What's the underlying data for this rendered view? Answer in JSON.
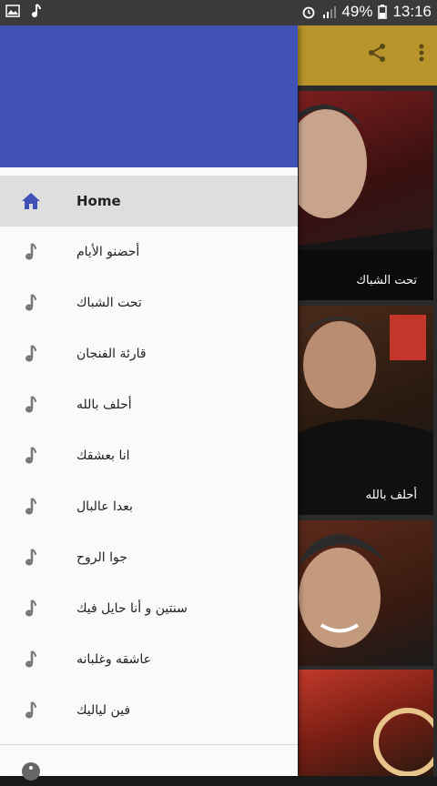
{
  "status_bar": {
    "battery": "49%",
    "time": "13:16",
    "left_icons": [
      "image-icon",
      "music-note-icon"
    ],
    "right_icons": [
      "alarm-icon",
      "signal-icon",
      "battery-icon"
    ]
  },
  "app": {
    "accent": "#b8942a",
    "toolbar_icons": [
      "share-icon",
      "more-vert-icon"
    ],
    "cards": [
      {
        "title": "تحت الشباك"
      },
      {
        "title": "أحلف بالله"
      },
      {
        "title": ""
      }
    ]
  },
  "drawer": {
    "header_color": "#3f51b5",
    "items": [
      {
        "label": "Home",
        "icon": "home-icon",
        "active": true
      },
      {
        "label": "أحضنو الأيام",
        "icon": "music-note-icon"
      },
      {
        "label": "تحت الشباك",
        "icon": "music-note-icon"
      },
      {
        "label": "قارئة الفنجان",
        "icon": "music-note-icon"
      },
      {
        "label": "أحلف بالله",
        "icon": "music-note-icon"
      },
      {
        "label": "انا بعشقك",
        "icon": "music-note-icon"
      },
      {
        "label": "بعدا عالبال",
        "icon": "music-note-icon"
      },
      {
        "label": "جوا الروح",
        "icon": "music-note-icon"
      },
      {
        "label": "سنتين و أنا حايل فيك",
        "icon": "music-note-icon"
      },
      {
        "label": "عاشقه وغلبانه",
        "icon": "music-note-icon"
      },
      {
        "label": "فين لياليك",
        "icon": "music-note-icon"
      }
    ],
    "partial_item_icon": "info-icon"
  }
}
